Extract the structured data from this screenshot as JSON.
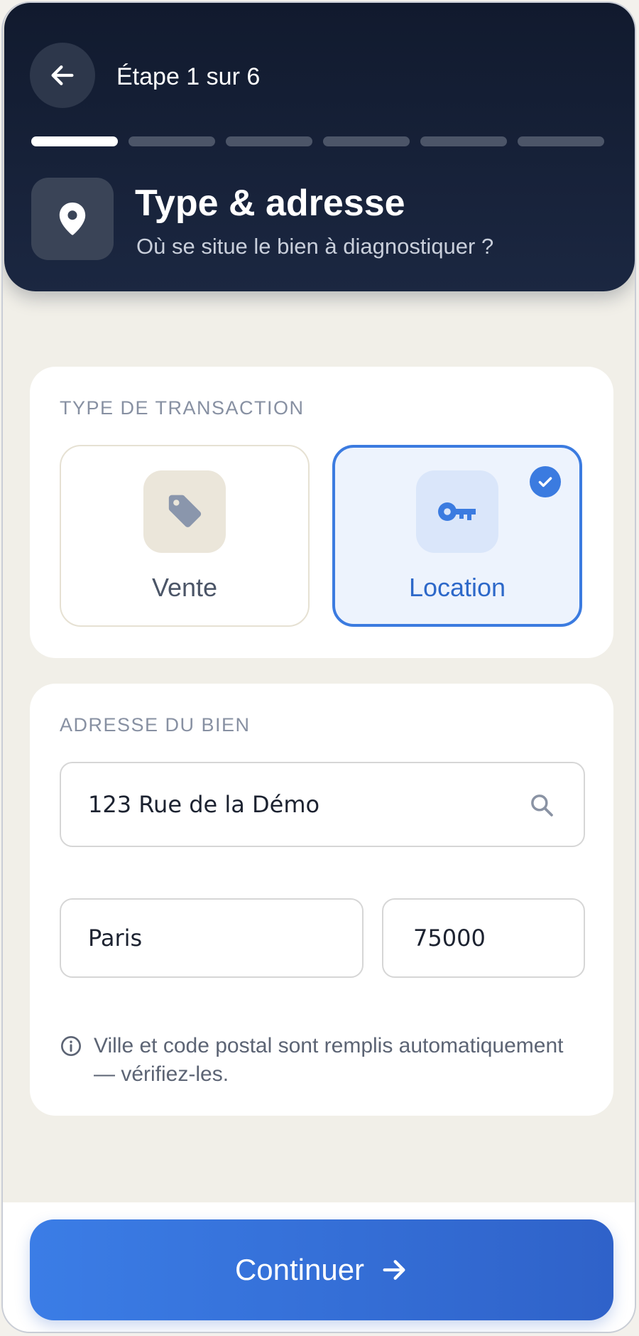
{
  "header": {
    "step_label": "Étape 1 sur 6",
    "progress": {
      "total_steps": 6,
      "current_step": 1
    },
    "title": "Type & adresse",
    "subtitle": "Où se situe le bien à diagnostiquer ?"
  },
  "transaction": {
    "section_label": "TYPE DE TRANSACTION",
    "options": [
      {
        "label": "Vente",
        "icon": "tag-icon",
        "selected": false
      },
      {
        "label": "Location",
        "icon": "key-icon",
        "selected": true
      }
    ]
  },
  "address": {
    "section_label": "ADRESSE DU BIEN",
    "street": "123 Rue de la Démo",
    "city": "Paris",
    "postal_code": "75000",
    "info": "Ville et code postal sont remplis automatiquement — vérifiez-les."
  },
  "footer": {
    "continue_label": "Continuer"
  },
  "colors": {
    "header_bg": "#111a2e",
    "accent": "#3b7be0",
    "page_bg": "#f1efe8"
  }
}
